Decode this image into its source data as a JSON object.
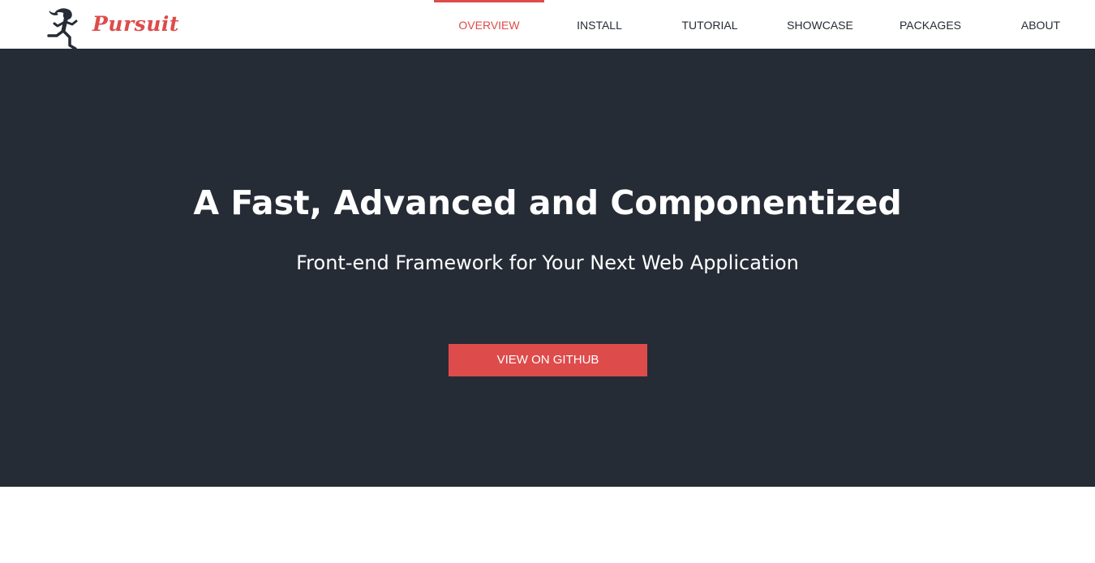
{
  "brand": {
    "name": "Pursuit",
    "logo_icon": "runner-icon",
    "accent_color": "#de4b4b",
    "dark_color": "#262c36"
  },
  "nav": {
    "items": [
      {
        "label": "OVERVIEW",
        "active": true
      },
      {
        "label": "INSTALL",
        "active": false
      },
      {
        "label": "TUTORIAL",
        "active": false
      },
      {
        "label": "SHOWCASE",
        "active": false
      },
      {
        "label": "PACKAGES",
        "active": false
      },
      {
        "label": "ABOUT",
        "active": false
      }
    ]
  },
  "hero": {
    "title": "A Fast, Advanced and Componentized",
    "subtitle": "Front-end Framework for Your Next Web Application",
    "cta_label": "VIEW ON GITHUB"
  }
}
